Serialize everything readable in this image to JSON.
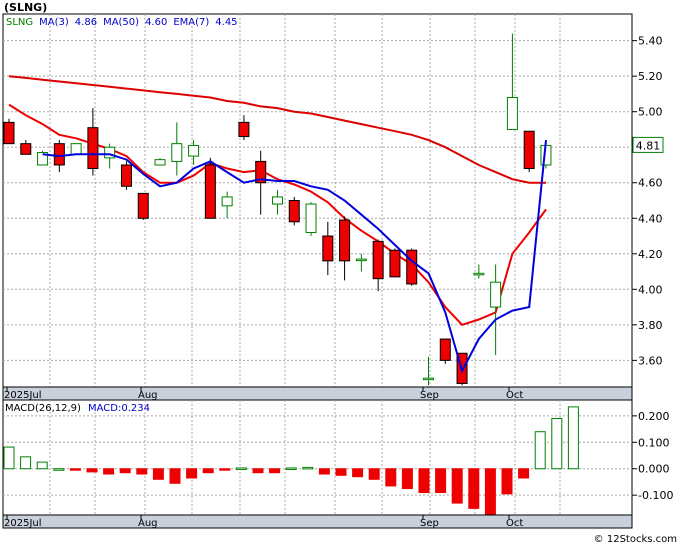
{
  "header": {
    "ticker_label": "(SLNG)",
    "legend": [
      {
        "text": "SLNG",
        "color": "#008000"
      },
      {
        "text": "MA(3)",
        "color": "#0000cc"
      },
      {
        "text": "4.86",
        "color": "#0000cc"
      },
      {
        "text": "MA(50)",
        "color": "#0000cc"
      },
      {
        "text": "4.60",
        "color": "#0000cc"
      },
      {
        "text": "EMA(7)",
        "color": "#0000cc"
      },
      {
        "text": "4.45",
        "color": "#0000cc"
      }
    ]
  },
  "macd_header": {
    "label": "MACD(26,12,9)",
    "value_text": "MACD:0.234"
  },
  "watermark": "© 12Stocks.com",
  "colors": {
    "up": "#008000",
    "down": "#ee0000",
    "ma3": "#0000dd",
    "ema7": "#ee0000",
    "ma50": "#dd0000",
    "grid": "#a8a8a8",
    "axis_bar": "#c8d0dc"
  },
  "chart_data": [
    {
      "type": "candlestick",
      "title": "",
      "ylim": [
        3.45,
        5.55
      ],
      "y_ticks": [
        "5.40",
        "5.20",
        "5.00",
        "4.80",
        "4.60",
        "4.40",
        "4.20",
        "4.00",
        "3.80",
        "3.60"
      ],
      "x_labels": [
        "2025Jul",
        "Aug",
        "Sep",
        "Oct"
      ],
      "last_price_label": "4.81",
      "candles": [
        {
          "o": 4.94,
          "h": 4.96,
          "l": 4.82,
          "c": 4.82
        },
        {
          "o": 4.82,
          "h": 4.84,
          "l": 4.76,
          "c": 4.76
        },
        {
          "o": 4.7,
          "h": 4.78,
          "l": 4.7,
          "c": 4.77
        },
        {
          "o": 4.82,
          "h": 4.84,
          "l": 4.66,
          "c": 4.7
        },
        {
          "o": 4.76,
          "h": 4.82,
          "l": 4.76,
          "c": 4.82
        },
        {
          "o": 4.91,
          "h": 5.02,
          "l": 4.64,
          "c": 4.68
        },
        {
          "o": 4.74,
          "h": 4.82,
          "l": 4.68,
          "c": 4.8
        },
        {
          "o": 4.7,
          "h": 4.72,
          "l": 4.56,
          "c": 4.58
        },
        {
          "o": 4.54,
          "h": 4.54,
          "l": 4.39,
          "c": 4.4
        },
        {
          "o": 4.7,
          "h": 4.74,
          "l": 4.7,
          "c": 4.73
        },
        {
          "o": 4.72,
          "h": 4.94,
          "l": 4.64,
          "c": 4.82
        },
        {
          "o": 4.75,
          "h": 4.84,
          "l": 4.7,
          "c": 4.81
        },
        {
          "o": 4.7,
          "h": 4.74,
          "l": 4.4,
          "c": 4.4
        },
        {
          "o": 4.47,
          "h": 4.55,
          "l": 4.4,
          "c": 4.52
        },
        {
          "o": 4.94,
          "h": 4.98,
          "l": 4.84,
          "c": 4.86
        },
        {
          "o": 4.72,
          "h": 4.78,
          "l": 4.42,
          "c": 4.6
        },
        {
          "o": 4.48,
          "h": 4.56,
          "l": 4.42,
          "c": 4.52
        },
        {
          "o": 4.5,
          "h": 4.52,
          "l": 4.36,
          "c": 4.38
        },
        {
          "o": 4.32,
          "h": 4.49,
          "l": 4.3,
          "c": 4.48
        },
        {
          "o": 4.3,
          "h": 4.38,
          "l": 4.08,
          "c": 4.16
        },
        {
          "o": 4.39,
          "h": 4.41,
          "l": 4.05,
          "c": 4.16
        },
        {
          "o": 4.17,
          "h": 4.2,
          "l": 4.1,
          "c": 4.17
        },
        {
          "o": 4.27,
          "h": 4.28,
          "l": 3.99,
          "c": 4.06
        },
        {
          "o": 4.22,
          "h": 4.23,
          "l": 4.07,
          "c": 4.07
        },
        {
          "o": 4.22,
          "h": 4.23,
          "l": 4.02,
          "c": 4.03
        },
        {
          "o": 3.5,
          "h": 3.62,
          "l": 3.46,
          "c": 3.5
        },
        {
          "o": 3.72,
          "h": 3.72,
          "l": 3.58,
          "c": 3.6
        },
        {
          "o": 3.64,
          "h": 3.64,
          "l": 3.46,
          "c": 3.47
        },
        {
          "o": 4.09,
          "h": 4.14,
          "l": 4.06,
          "c": 4.09
        },
        {
          "o": 3.9,
          "h": 4.14,
          "l": 3.63,
          "c": 4.04
        },
        {
          "o": 4.9,
          "h": 5.44,
          "l": 4.9,
          "c": 5.08
        },
        {
          "o": 4.89,
          "h": 4.89,
          "l": 4.66,
          "c": 4.68
        },
        {
          "o": 4.7,
          "h": 4.84,
          "l": 4.68,
          "c": 4.81
        }
      ],
      "ma3": [
        null,
        null,
        4.76,
        4.75,
        4.76,
        4.76,
        4.76,
        4.73,
        4.65,
        4.58,
        4.6,
        4.68,
        4.72,
        4.66,
        4.6,
        4.62,
        4.61,
        4.61,
        4.58,
        4.56,
        4.5,
        4.42,
        4.34,
        4.25,
        4.16,
        4.09,
        3.87,
        3.54,
        3.72,
        3.83,
        3.88,
        3.9,
        4.84
      ],
      "ema7": [
        5.04,
        4.98,
        4.93,
        4.87,
        4.85,
        4.82,
        4.79,
        4.75,
        4.66,
        4.6,
        4.6,
        4.64,
        4.71,
        4.68,
        4.66,
        4.67,
        4.62,
        4.59,
        4.55,
        4.49,
        4.4,
        4.33,
        4.27,
        4.2,
        4.14,
        4.04,
        3.9,
        3.8,
        3.83,
        3.87,
        4.2,
        4.32,
        4.45
      ],
      "ma50": [
        5.2,
        5.19,
        5.18,
        5.17,
        5.16,
        5.15,
        5.14,
        5.13,
        5.12,
        5.11,
        5.1,
        5.09,
        5.08,
        5.06,
        5.05,
        5.03,
        5.02,
        5.0,
        4.99,
        4.97,
        4.95,
        4.93,
        4.91,
        4.89,
        4.87,
        4.84,
        4.8,
        4.75,
        4.7,
        4.66,
        4.62,
        4.6,
        4.6
      ]
    },
    {
      "type": "bar",
      "title": "MACD(26,12,9)",
      "ylim": [
        -0.175,
        0.26
      ],
      "y_ticks": [
        "0.200",
        "0.100",
        "0.000",
        "-0.100"
      ],
      "x_labels": [
        "2025Jul",
        "Aug",
        "Sep",
        "Oct"
      ],
      "values": [
        0.082,
        0.045,
        0.025,
        0.0,
        -0.004,
        -0.012,
        -0.02,
        -0.015,
        -0.02,
        -0.04,
        -0.055,
        -0.035,
        -0.015,
        -0.005,
        0.003,
        -0.015,
        -0.015,
        0.003,
        0.005,
        -0.02,
        -0.025,
        -0.03,
        -0.04,
        -0.065,
        -0.075,
        -0.09,
        -0.09,
        -0.13,
        -0.15,
        -0.175,
        -0.095,
        -0.035,
        0.14,
        0.19,
        0.234
      ]
    }
  ]
}
